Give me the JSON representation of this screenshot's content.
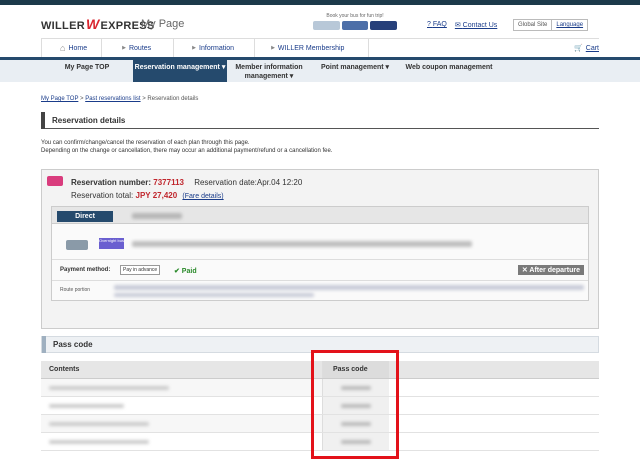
{
  "header": {
    "logo_left": "WILLER",
    "logo_w": "W",
    "logo_right": "EXPRESS",
    "page_title": "My Page",
    "promo_caption": "Book your bus for fun trip!",
    "faq": "FAQ",
    "contact": "Contact Us",
    "global_site": "Global Site",
    "language": "Language",
    "bus_colors": [
      "#b8c8d8",
      "#4d6fa8",
      "#27407a"
    ]
  },
  "nav_primary": {
    "items": [
      {
        "label": "Home",
        "icon": "home-icon"
      },
      {
        "label": "Routes",
        "icon": "arrow-right-icon"
      },
      {
        "label": "Information",
        "icon": "arrow-right-icon"
      },
      {
        "label": "WILLER Membership",
        "icon": "arrow-right-icon"
      }
    ],
    "cart": "Cart"
  },
  "nav_secondary": {
    "items": [
      {
        "label": "My Page TOP"
      },
      {
        "label": "Reservation management ▾"
      },
      {
        "label": "Member information management ▾"
      },
      {
        "label": "Point management ▾"
      },
      {
        "label": "Web coupon management"
      }
    ]
  },
  "breadcrumb": {
    "link1": "My Page TOP",
    "link2": "Past reservations list",
    "current": "Reservation details"
  },
  "reservation_details": {
    "title": "Reservation details",
    "intro_line1": "You can confirm/change/cancel the reservation of each plan through this page.",
    "intro_line2": "Depending on the change or cancellation, there may occur an additional payment/refund or a cancellation fee.",
    "number_label": "Reservation number:",
    "number": "7377113",
    "date_label": "Reservation date:",
    "date": "Apr.04 12:20",
    "total_label": "Reservation total:",
    "total": "JPY 27,420",
    "fare_details": "(Fare details)",
    "plan_type": "Direct",
    "overnight_tag": "Overnight bus",
    "payment_label": "Payment method:",
    "payment_value": "Pay in advance",
    "paid": "✔ Paid",
    "after_departure": "✕ After departure",
    "route_portion": "Route portion"
  },
  "pass_code": {
    "title": "Pass code",
    "col_contents": "Contents",
    "col_code": "Pass code",
    "row_count_visible": 4
  },
  "colors": {
    "accent_navy": "#254a6d",
    "price_red": "#c0262d",
    "paid_green": "#2a8a2a",
    "highlight_red": "#e3121a"
  }
}
